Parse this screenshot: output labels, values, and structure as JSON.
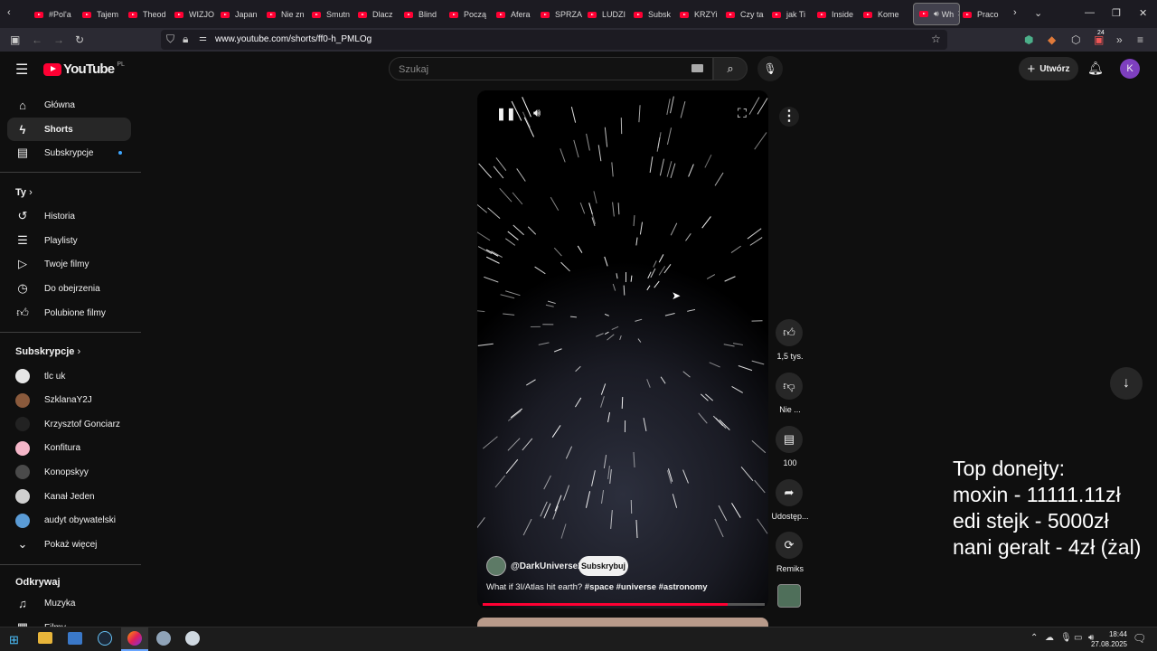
{
  "browser": {
    "tabs": [
      {
        "label": "#Pol'a"
      },
      {
        "label": "Tajem"
      },
      {
        "label": "Theod"
      },
      {
        "label": "WIZJO"
      },
      {
        "label": "Japan"
      },
      {
        "label": "Nie zn"
      },
      {
        "label": "Smutn"
      },
      {
        "label": "Dlacz"
      },
      {
        "label": "Blind"
      },
      {
        "label": "Począ"
      },
      {
        "label": "Afera"
      },
      {
        "label": "SPRZA"
      },
      {
        "label": "LUDZI"
      },
      {
        "label": "Subsk"
      },
      {
        "label": "KRZYi"
      },
      {
        "label": "Czy ta"
      },
      {
        "label": "jak Ti"
      },
      {
        "label": "Inside"
      },
      {
        "label": "Kome"
      },
      {
        "label": "Wh"
      },
      {
        "label": "Praco"
      }
    ],
    "url": "www.youtube.com/shorts/ff0-h_PMLOg",
    "badge_count": "24"
  },
  "youtube": {
    "logo": "YouTube",
    "region": "PL",
    "search_placeholder": "Szukaj",
    "create_label": "Utwórz",
    "avatar_letter": "K"
  },
  "sidebar": {
    "main": [
      {
        "label": "Główna",
        "icon": "home-icon"
      },
      {
        "label": "Shorts",
        "icon": "shorts-icon"
      },
      {
        "label": "Subskrypcje",
        "icon": "subscriptions-icon"
      }
    ],
    "you_title": "Ty",
    "you": [
      {
        "label": "Historia",
        "icon": "history-icon"
      },
      {
        "label": "Playlisty",
        "icon": "playlists-icon"
      },
      {
        "label": "Twoje filmy",
        "icon": "your-videos-icon"
      },
      {
        "label": "Do obejrzenia",
        "icon": "watch-later-icon"
      },
      {
        "label": "Polubione filmy",
        "icon": "liked-icon"
      }
    ],
    "subs_title": "Subskrypcje",
    "subs": [
      {
        "label": "tlc uk",
        "color": "#e6e6e6"
      },
      {
        "label": "SzklanaY2J",
        "color": "#8a5a3c"
      },
      {
        "label": "Krzysztof Gonciarz",
        "color": "#222222"
      },
      {
        "label": "Konfitura",
        "color": "#f4b6c8"
      },
      {
        "label": "Konopskyy",
        "color": "#4a4a4a"
      },
      {
        "label": "Kanał Jeden",
        "color": "#cfcfcf"
      },
      {
        "label": "audyt obywatelski",
        "color": "#5a9bd5"
      }
    ],
    "show_more": "Pokaż więcej",
    "explore_title": "Odkrywaj",
    "explore": [
      {
        "label": "Muzyka",
        "icon": "music-icon"
      },
      {
        "label": "Filmy",
        "icon": "film-icon"
      }
    ]
  },
  "short": {
    "channel": "@DarkUniverse2",
    "subscribe_label": "Subskrybuj",
    "title": "What if 3I/Atlas hit earth?",
    "hashtags": "#space #universe #astronomy",
    "progress": 0.87,
    "actions": {
      "likes": "1,5 tys.",
      "dislike": "Nie ...",
      "comments": "100",
      "share": "Udostęp...",
      "remix": "Remiks"
    }
  },
  "overlay": {
    "lines": [
      "Top donejty:",
      "moxin - 11111.11zł",
      "edi stejk - 5000zł",
      "nani geralt - 4zł (żal)"
    ]
  },
  "taskbar": {
    "time": "18:44",
    "date": "27.08.2025"
  }
}
